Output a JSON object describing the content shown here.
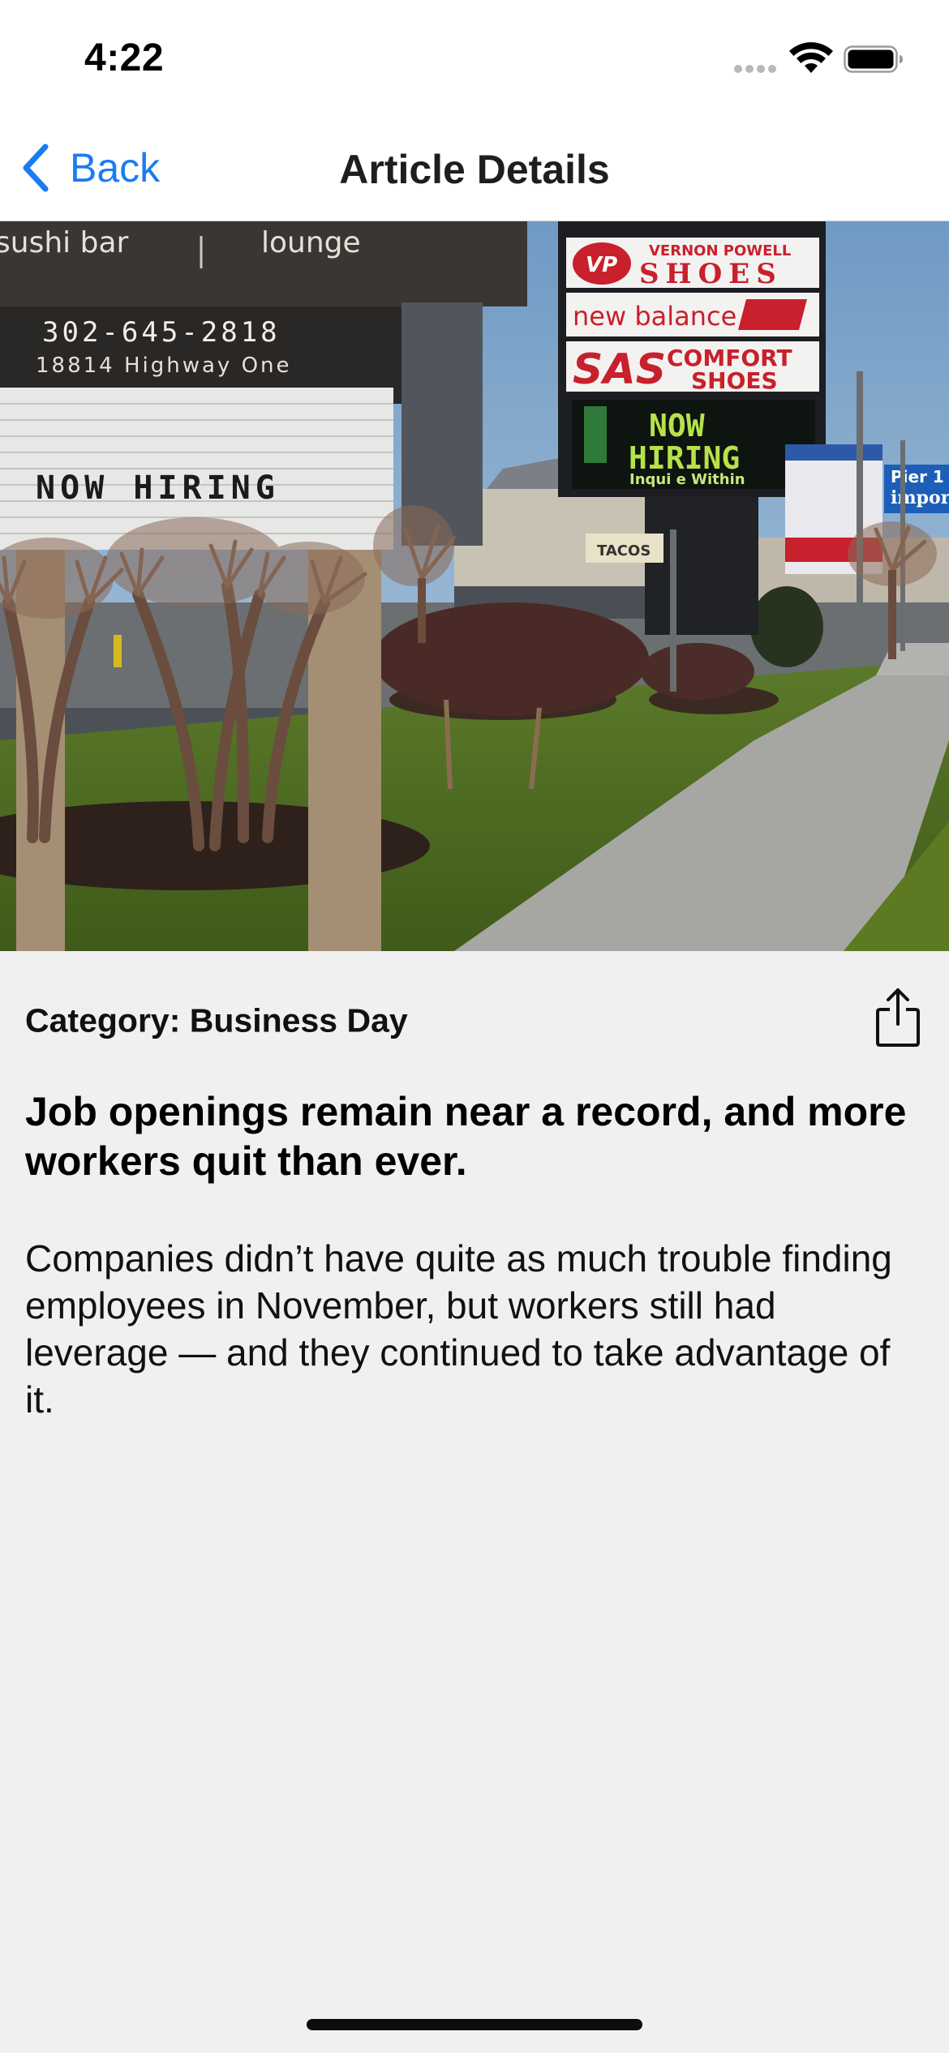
{
  "status_bar": {
    "time": "4:22"
  },
  "nav": {
    "back_label": "Back",
    "title": "Article Details"
  },
  "hero_image": {
    "signs": {
      "sushi_bar": "sushi bar",
      "lounge": "lounge",
      "phone": "302-645-2818",
      "address": "18814 Highway One",
      "now_hiring_board": "NOW HIRING",
      "vernon_powell": "VERNON POWELL",
      "vp_logo": "VP",
      "shoes": "SHOES",
      "new_balance": "new balance",
      "sas": "SAS",
      "comfort": "COMFORT",
      "comfort_shoes": "SHOES",
      "now_led": "NOW",
      "hiring_led": "HIRING",
      "inquire": "Inqui e Within",
      "tacos": "TACOS",
      "pier1": "Pier 1",
      "imports": "impor"
    }
  },
  "article": {
    "category_label": "Category:",
    "category": "Business Day",
    "headline": "Job openings remain near a record, and more workers quit than ever.",
    "summary": "Companies didn’t have quite as much trouble finding employees in November, but workers still had leverage — and they continued to take advantage of it."
  },
  "colors": {
    "accent": "#1a7cf2",
    "background": "#f0f0f0",
    "bar": "#ffffff"
  },
  "icons": {
    "back": "chevron-left-icon",
    "share": "share-icon",
    "wifi": "wifi-icon",
    "battery": "battery-icon",
    "signal": "cellular-signal-icon"
  }
}
